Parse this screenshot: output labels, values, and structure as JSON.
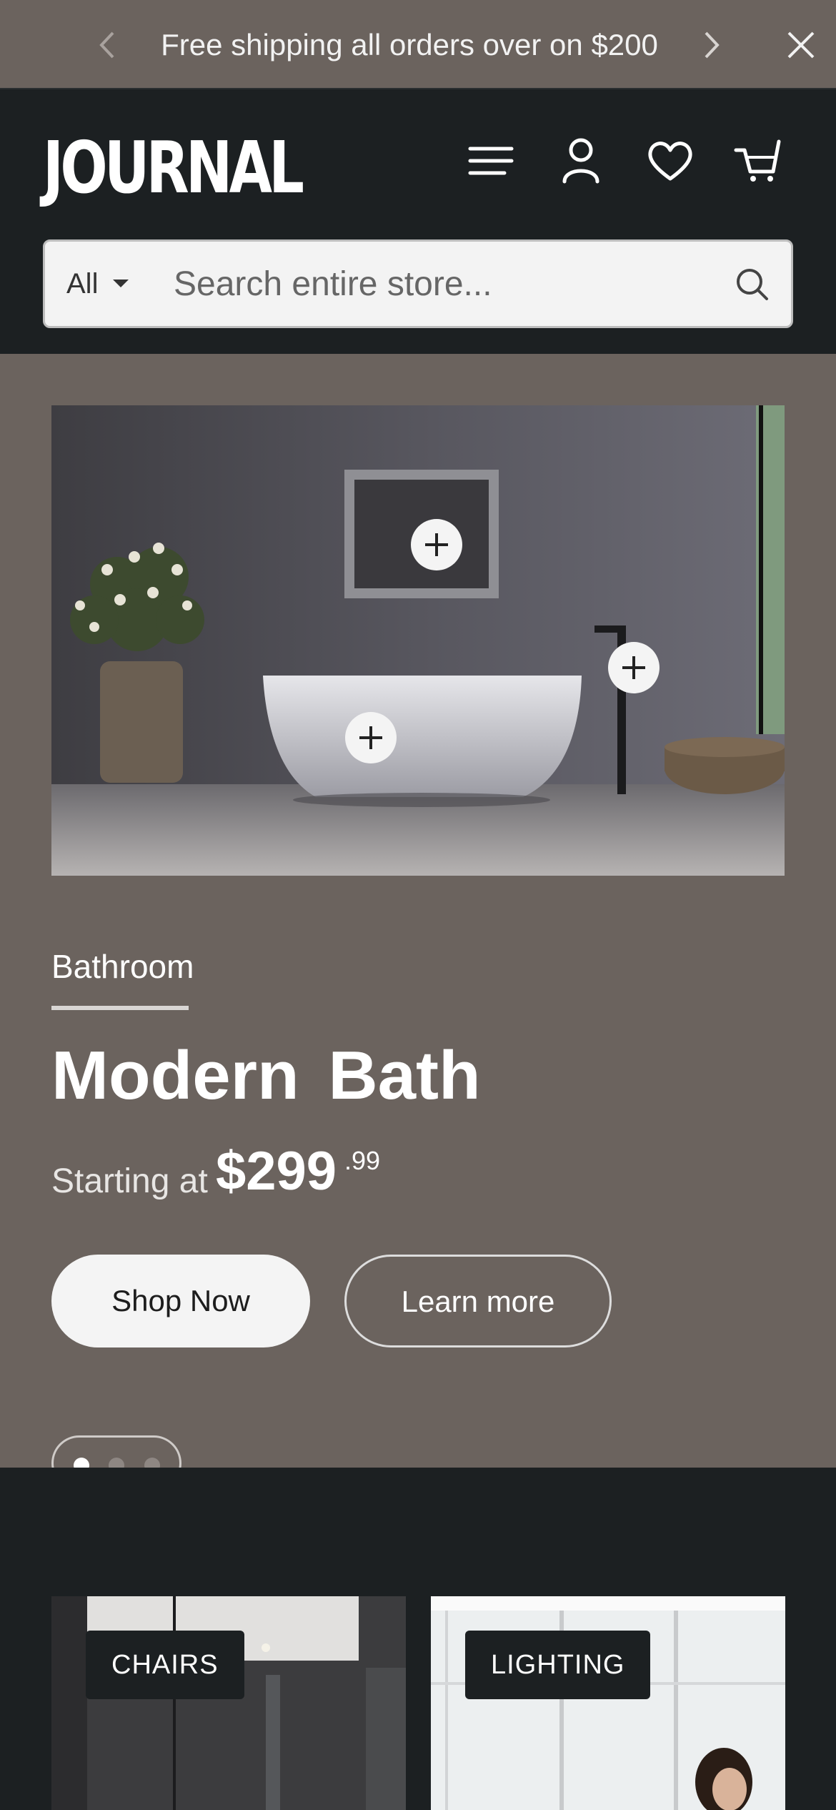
{
  "announcement": {
    "text": "Free shipping all orders over on $200",
    "prev_icon": "chevron-left-icon",
    "next_icon": "chevron-right-icon",
    "close_icon": "close-icon"
  },
  "header": {
    "logo": "JOURNAL",
    "icons": [
      "menu-icon",
      "account-icon",
      "wishlist-icon",
      "cart-icon"
    ],
    "search": {
      "category": "All",
      "placeholder": "Search entire store...",
      "icon": "search-icon"
    }
  },
  "hero": {
    "category": "Bathroom",
    "title": "Modern Bath",
    "price_prefix": "Starting at",
    "price": "$299",
    "price_cents": ".99",
    "primary_button": "Shop Now",
    "secondary_button": "Learn more",
    "slides": {
      "total": 3,
      "active": 1
    }
  },
  "categories": [
    {
      "label": "CHAIRS"
    },
    {
      "label": "LIGHTING"
    }
  ],
  "colors": {
    "announcement_bg": "#6b635e",
    "header_bg": "#1c2022",
    "hero_bg": "#6b635e",
    "button_light": "#f4f4f4"
  }
}
